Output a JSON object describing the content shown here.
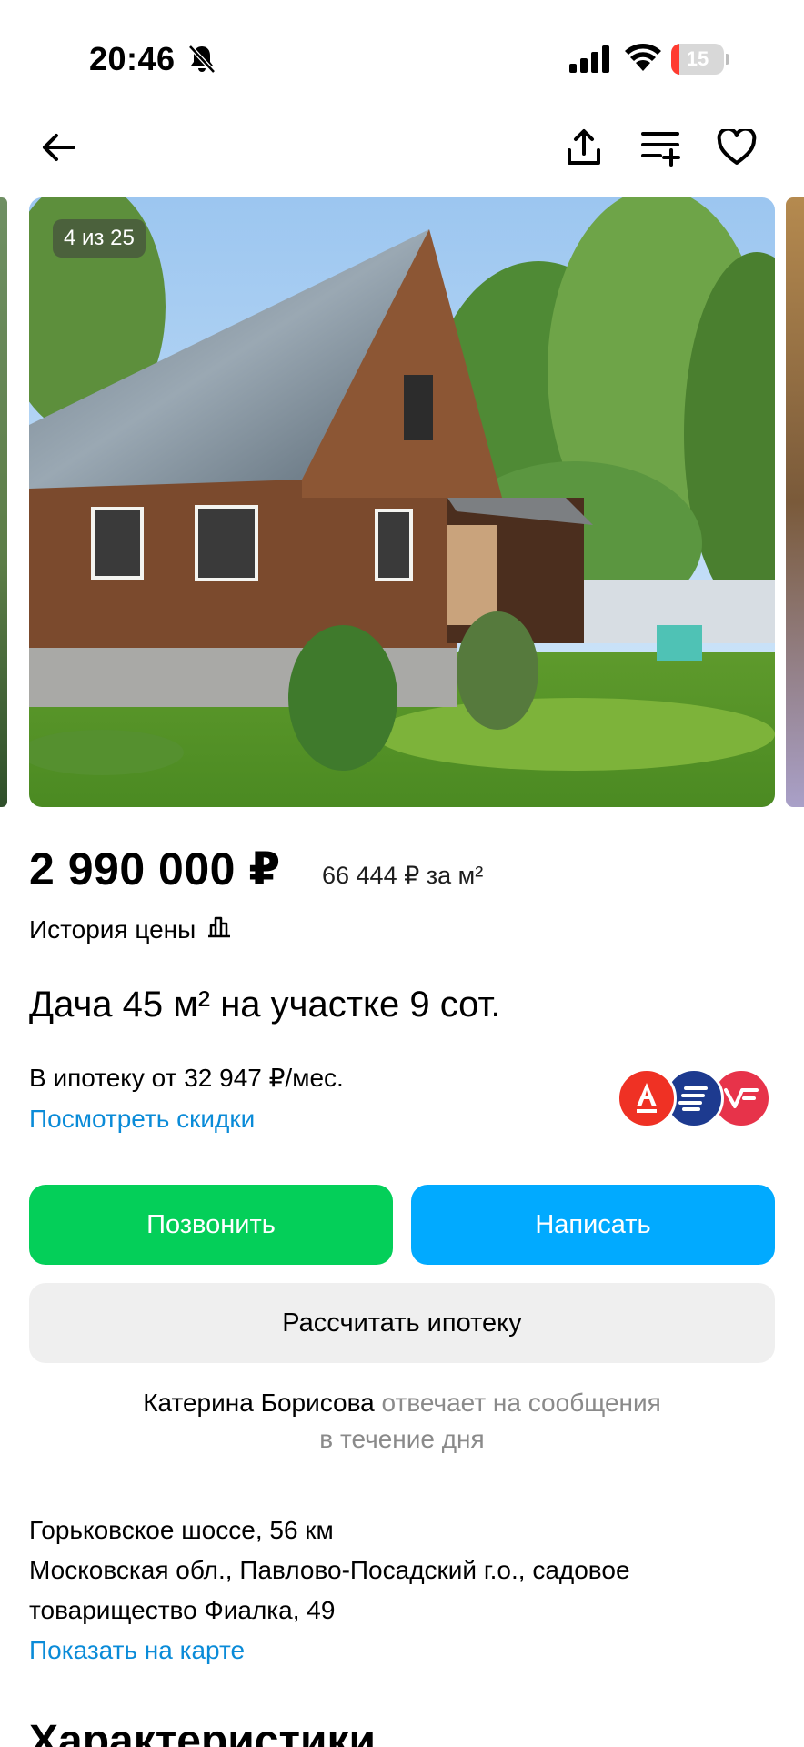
{
  "status_bar": {
    "time": "20:46",
    "battery": "15",
    "battery_level": 0.15
  },
  "gallery": {
    "counter": "4 из 25"
  },
  "listing": {
    "price": "2 990 000 ₽",
    "price_per_m2": "66 444 ₽ за м²",
    "price_history": "История цены",
    "title": "Дача 45 м² на участке 9 сот.",
    "mortgage_text": "В ипотеку от 32 947 ₽/мес.",
    "discounts_link": "Посмотреть скидки"
  },
  "actions": {
    "call": "Позвонить",
    "write": "Написать",
    "calculate": "Рассчитать ипотеку"
  },
  "seller": {
    "name": "Катерина Борисова",
    "response_1": "отвечает на сообщения",
    "response_2": "в течение дня"
  },
  "address": {
    "highway": "Горьковское шоссе, 56 км",
    "line1": "Московская обл., Павлово-Посадский г.о., садовое",
    "line2": "товарищество Фиалка, 49",
    "map_link": "Показать на карте"
  },
  "sections": {
    "characteristics": "Характеристики"
  },
  "colors": {
    "call": "#04cf59",
    "write": "#01aaff",
    "link": "#0a8bd8",
    "bank_a": "#ef3124",
    "bank_b": "#1d3a8f",
    "bank_c": "#e7334a"
  },
  "icons": [
    "bell-muted-icon",
    "signal-icon",
    "wifi-icon",
    "battery-icon",
    "back-arrow-icon",
    "share-icon",
    "compare-icon",
    "heart-icon",
    "price-history-chart-icon",
    "alfa-bank-logo",
    "bank-logo",
    "bank-logo-red"
  ]
}
